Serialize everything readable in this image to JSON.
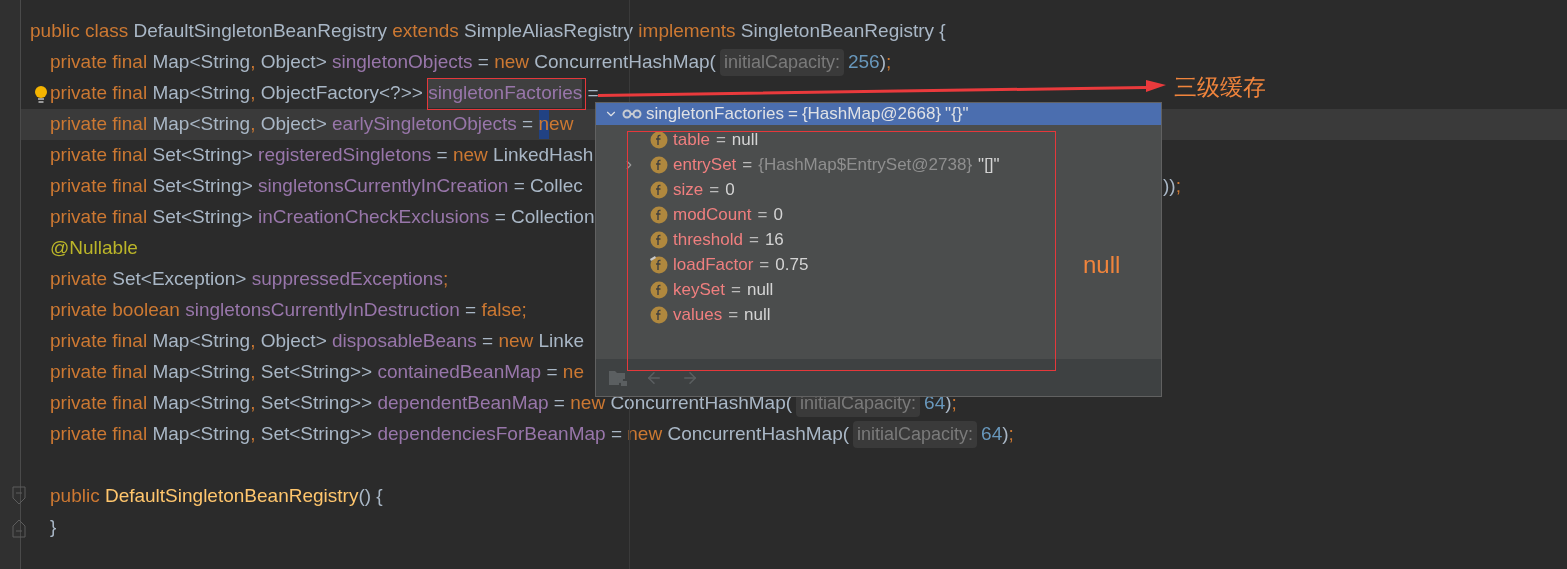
{
  "editor": {
    "lines": [
      {
        "kind": "code",
        "current": false,
        "tokens": [
          {
            "kind": "keyword",
            "text": "public class "
          },
          {
            "kind": "plain",
            "text": "DefaultSingletonBeanRegistry "
          },
          {
            "kind": "keyword",
            "text": "extends "
          },
          {
            "kind": "plain",
            "text": "SimpleAliasRegistry "
          },
          {
            "kind": "keyword",
            "text": "implements "
          },
          {
            "kind": "plain",
            "text": "SingletonBeanRegistry {"
          }
        ],
        "children": [
          {
            "kind": "code",
            "current": false,
            "tokens": [
              {
                "kind": "keyword",
                "text": "private final "
              },
              {
                "kind": "plain",
                "text": "Map<String"
              },
              {
                "kind": "keyword",
                "text": ", "
              },
              {
                "kind": "plain",
                "text": "Object> "
              },
              {
                "kind": "field",
                "text": "singletonObjects"
              },
              {
                "kind": "plain",
                "text": " = "
              },
              {
                "kind": "keyword",
                "text": "new "
              },
              {
                "kind": "plain",
                "text": "ConcurrentHashMap("
              },
              {
                "kind": "hint",
                "text": "initialCapacity:"
              },
              {
                "kind": "number",
                "text": "256"
              },
              {
                "kind": "plain",
                "text": ")"
              },
              {
                "kind": "keyword",
                "text": ";"
              }
            ]
          },
          {
            "kind": "code",
            "current": false,
            "gutter_marker": {
              "kind": "bulb"
            },
            "tokens": [
              {
                "kind": "keyword",
                "text": "private final "
              },
              {
                "kind": "plain",
                "text": "Map<String"
              },
              {
                "kind": "keyword",
                "text": ", "
              },
              {
                "kind": "plain",
                "text": "ObjectFactory<?>> "
              },
              {
                "kind": "field_usage",
                "text": "singletonFactories"
              },
              {
                "kind": "plain",
                "text": " ="
              }
            ]
          },
          {
            "kind": "code",
            "current": true,
            "tokens": [
              {
                "kind": "keyword",
                "text": "private final "
              },
              {
                "kind": "plain",
                "text": "Map<String"
              },
              {
                "kind": "keyword",
                "text": ", "
              },
              {
                "kind": "plain",
                "text": "Object> "
              },
              {
                "kind": "field",
                "text": "earlySingletonObjects"
              },
              {
                "kind": "plain",
                "text": " = "
              },
              {
                "kind": "selection",
                "text": "n"
              },
              {
                "kind": "keyword",
                "text": "ew"
              }
            ]
          },
          {
            "kind": "code",
            "current": false,
            "tokens": [
              {
                "kind": "keyword",
                "text": "private final "
              },
              {
                "kind": "plain",
                "text": "Set<String> "
              },
              {
                "kind": "field",
                "text": "registeredSingletons"
              },
              {
                "kind": "plain",
                "text": " = "
              },
              {
                "kind": "keyword",
                "text": "new "
              },
              {
                "kind": "plain",
                "text": "LinkedHash"
              }
            ]
          },
          {
            "kind": "code",
            "current": false,
            "tokens": [
              {
                "kind": "keyword",
                "text": "private final "
              },
              {
                "kind": "plain",
                "text": "Set<String> "
              },
              {
                "kind": "field",
                "text": "singletonsCurrentlyInCreation"
              },
              {
                "kind": "plain",
                "text": " = Collec"
              }
            ],
            "tail": [
              {
                "kind": "plain",
                "text": "))"
              },
              {
                "kind": "keyword",
                "text": ";"
              }
            ]
          },
          {
            "kind": "code",
            "current": false,
            "tokens": [
              {
                "kind": "keyword",
                "text": "private final "
              },
              {
                "kind": "plain",
                "text": "Set<String> "
              },
              {
                "kind": "field",
                "text": "inCreationCheckExclusions"
              },
              {
                "kind": "plain",
                "text": " = Collection"
              }
            ]
          },
          {
            "kind": "code",
            "current": false,
            "tokens": [
              {
                "kind": "annotation",
                "text": "@Nullable"
              }
            ]
          },
          {
            "kind": "code",
            "current": false,
            "tokens": [
              {
                "kind": "keyword",
                "text": "private "
              },
              {
                "kind": "plain",
                "text": "Set<Exception> "
              },
              {
                "kind": "field",
                "text": "suppressedExceptions"
              },
              {
                "kind": "keyword",
                "text": ";"
              }
            ]
          },
          {
            "kind": "code",
            "current": false,
            "tokens": [
              {
                "kind": "keyword",
                "text": "private boolean "
              },
              {
                "kind": "field",
                "text": "singletonsCurrentlyInDestruction"
              },
              {
                "kind": "plain",
                "text": " = "
              },
              {
                "kind": "keyword",
                "text": "false;"
              }
            ]
          },
          {
            "kind": "code",
            "current": false,
            "tokens": [
              {
                "kind": "keyword",
                "text": "private final "
              },
              {
                "kind": "plain",
                "text": "Map<String"
              },
              {
                "kind": "keyword",
                "text": ", "
              },
              {
                "kind": "plain",
                "text": "Object> "
              },
              {
                "kind": "field",
                "text": "disposableBeans"
              },
              {
                "kind": "plain",
                "text": " = "
              },
              {
                "kind": "keyword",
                "text": "new "
              },
              {
                "kind": "plain",
                "text": "Linke"
              }
            ]
          },
          {
            "kind": "code",
            "current": false,
            "tokens": [
              {
                "kind": "keyword",
                "text": "private final "
              },
              {
                "kind": "plain",
                "text": "Map<String"
              },
              {
                "kind": "keyword",
                "text": ", "
              },
              {
                "kind": "plain",
                "text": "Set<String>> "
              },
              {
                "kind": "field",
                "text": "containedBeanMap"
              },
              {
                "kind": "plain",
                "text": " = "
              },
              {
                "kind": "keyword",
                "text": "ne"
              }
            ]
          },
          {
            "kind": "code",
            "current": false,
            "tokens": [
              {
                "kind": "keyword",
                "text": "private final "
              },
              {
                "kind": "plain",
                "text": "Map<String"
              },
              {
                "kind": "keyword",
                "text": ", "
              },
              {
                "kind": "plain",
                "text": "Set<String>> "
              },
              {
                "kind": "field",
                "text": "dependentBeanMap"
              },
              {
                "kind": "plain",
                "text": " = "
              },
              {
                "kind": "keyword",
                "text": "new "
              },
              {
                "kind": "plain",
                "text": "ConcurrentHashMap("
              },
              {
                "kind": "hint",
                "text": "initialCapacity:"
              },
              {
                "kind": "number",
                "text": "64"
              },
              {
                "kind": "plain",
                "text": ")"
              },
              {
                "kind": "keyword",
                "text": ";"
              }
            ]
          },
          {
            "kind": "code",
            "current": false,
            "tokens": [
              {
                "kind": "keyword",
                "text": "private final "
              },
              {
                "kind": "plain",
                "text": "Map<String"
              },
              {
                "kind": "keyword",
                "text": ", "
              },
              {
                "kind": "plain",
                "text": "Set<String>> "
              },
              {
                "kind": "field",
                "text": "dependenciesForBeanMap"
              },
              {
                "kind": "plain",
                "text": " = "
              },
              {
                "kind": "keyword",
                "text": "new "
              },
              {
                "kind": "plain",
                "text": "ConcurrentHashMap("
              },
              {
                "kind": "hint",
                "text": "initialCapacity:"
              },
              {
                "kind": "number",
                "text": "64"
              },
              {
                "kind": "plain",
                "text": ")"
              },
              {
                "kind": "keyword",
                "text": ";"
              }
            ]
          },
          {
            "kind": "blank",
            "current": false
          },
          {
            "kind": "code",
            "current": false,
            "gutter_marker": {
              "kind": "fold_start"
            },
            "tokens": [
              {
                "kind": "keyword",
                "text": "public "
              },
              {
                "kind": "method",
                "text": "DefaultSingletonBeanRegistry"
              },
              {
                "kind": "plain",
                "text": "() {"
              }
            ]
          },
          {
            "kind": "code",
            "current": false,
            "gutter_marker": {
              "kind": "fold_end"
            },
            "tokens": [
              {
                "kind": "plain",
                "text": "}"
              }
            ]
          }
        ]
      }
    ]
  },
  "popup": {
    "header": {
      "expanded": true,
      "name": "singletonFactories",
      "operator": "=",
      "value": "{HashMap@2668}",
      "summary": "\"{}\""
    },
    "fields": [
      {
        "name": "table",
        "operator": "=",
        "value": "null",
        "expandable": false,
        "marked": false
      },
      {
        "name": "entrySet",
        "operator": "=",
        "type": "{HashMap$EntrySet@2738}",
        "value": "\"[]\"",
        "expandable": true,
        "marked": false
      },
      {
        "name": "size",
        "operator": "=",
        "value": "0",
        "expandable": false,
        "marked": false
      },
      {
        "name": "modCount",
        "operator": "=",
        "value": "0",
        "expandable": false,
        "marked": false
      },
      {
        "name": "threshold",
        "operator": "=",
        "value": "16",
        "expandable": false,
        "marked": false
      },
      {
        "name": "loadFactor",
        "operator": "=",
        "value": "0.75",
        "expandable": false,
        "marked": true
      },
      {
        "name": "keySet",
        "operator": "=",
        "value": "null",
        "expandable": false,
        "marked": false
      },
      {
        "name": "values",
        "operator": "=",
        "value": "null",
        "expandable": false,
        "marked": false
      }
    ],
    "toolbar": [
      {
        "kind": "tree",
        "disabled": true
      },
      {
        "kind": "back",
        "disabled": true
      },
      {
        "kind": "forward",
        "disabled": true
      }
    ]
  },
  "annotations": {
    "callout": "三级缓存",
    "note": "null"
  }
}
